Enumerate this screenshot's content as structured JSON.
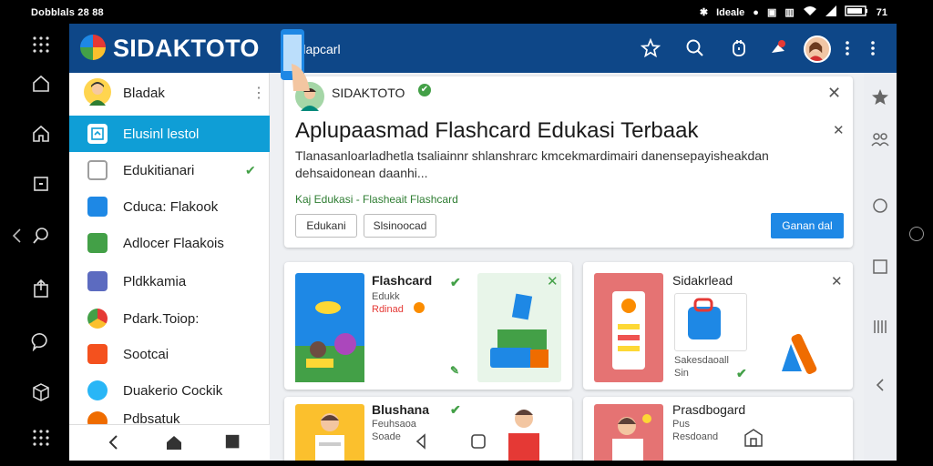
{
  "status": {
    "left_text": "Dobblals 28 88",
    "right_text": "Ideale",
    "battery": "71"
  },
  "app": {
    "brand": "SIDAKTOTO",
    "title": "Plapcarl"
  },
  "sidebar": {
    "user": "Bladak",
    "items": [
      {
        "label": "Elusinl lestol"
      },
      {
        "label": "Edukitianari"
      },
      {
        "label": "Cduca: Flakook"
      },
      {
        "label": "Adlocer Flaakois"
      },
      {
        "label": "Pldkkamia"
      },
      {
        "label": "Pdark.Toiop:"
      },
      {
        "label": "Sootcai"
      },
      {
        "label": "Duakerio Cockik"
      },
      {
        "label": "Pdbsatuk"
      }
    ]
  },
  "hero": {
    "name": "SIDAKTOTO",
    "title": "Aplupaasmad Flashcard Edukasi  Terbaak",
    "description": "Tlanasanloarladhetla tsaliainnr shlanshrarc kmcekmardimairi danensepayisheakdan dehsaidonean daanhi...",
    "tag": "Kaj Edukasi - Flasheait Flashcard",
    "chips": [
      "Edukani",
      "Slsinoocad"
    ],
    "button": "Ganan dal"
  },
  "cards": [
    {
      "title": "Flashcard",
      "subtitle": "Edukk",
      "note": "Rdinad"
    },
    {
      "title": "Sidakrlead",
      "subtitle": "Sakesdaoall",
      "note": "Sin"
    },
    {
      "title": "Blushana",
      "subtitle": "Feuhsaoa",
      "note": "Soade"
    },
    {
      "title": "Prasdbogard",
      "subtitle": "Pus",
      "note": "Resdoand"
    }
  ],
  "colors": {
    "appbar": "#0e4788",
    "active": "#0f9ed6",
    "accent": "#1e88e5"
  }
}
